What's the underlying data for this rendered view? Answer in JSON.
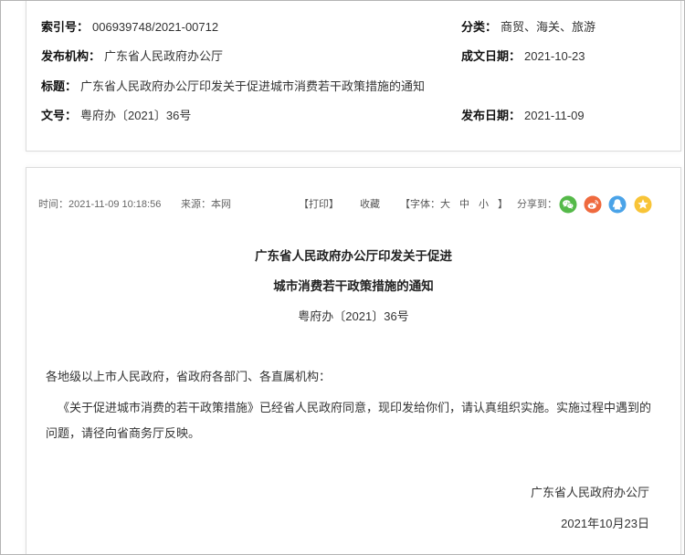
{
  "meta": {
    "index_label": "索引号：",
    "index_value": "006939748/2021-00712",
    "category_label": "分类：",
    "category_value": "商贸、海关、旅游",
    "publisher_label": "发布机构：",
    "publisher_value": "广东省人民政府办公厅",
    "written_date_label": "成文日期：",
    "written_date_value": "2021-10-23",
    "title_label": "标题：",
    "title_value": "广东省人民政府办公厅印发关于促进城市消费若干政策措施的通知",
    "doc_no_label": "文号：",
    "doc_no_value": "粤府办〔2021〕36号",
    "publish_date_label": "发布日期：",
    "publish_date_value": "2021-11-09"
  },
  "info_bar": {
    "time": "时间：2021-11-09 10:18:56",
    "source": "来源：本网",
    "print": "【打印】",
    "favorite": "收藏",
    "font_prefix": "【字体：",
    "font_large": "大",
    "font_medium": "中",
    "font_small": "小",
    "font_suffix": "】",
    "share": "分享到：",
    "share_icons": [
      "wechat-icon",
      "weibo-icon",
      "qq-icon",
      "star-icon"
    ]
  },
  "article": {
    "title_line1": "广东省人民政府办公厅印发关于促进",
    "title_line2": "城市消费若干政策措施的通知",
    "doc_number": "粤府办〔2021〕36号",
    "salutation": "各地级以上市人民政府，省政府各部门、各直属机构：",
    "body": "《关于促进城市消费的若干政策措施》已经省人民政府同意，现印发给你们，请认真组织实施。实施过程中遇到的问题，请径向省商务厅反映。",
    "signature": "广东省人民政府办公厅",
    "date": "2021年10月23日"
  },
  "colors": {
    "label": "#111111",
    "text": "#333333",
    "muted": "#666666",
    "border": "#dcdcdc",
    "wechat": "#55b949",
    "weibo": "#ef6a3e",
    "qq": "#4aa3e8",
    "star": "#f8c437"
  }
}
